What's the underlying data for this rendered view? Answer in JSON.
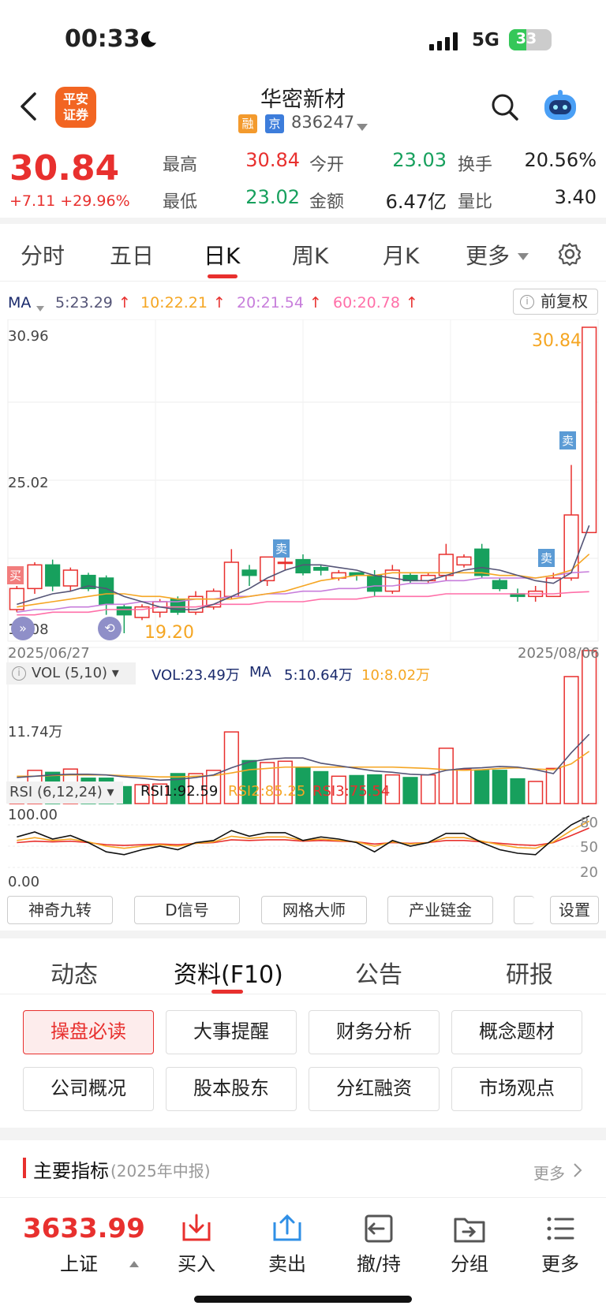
{
  "status_bar": {
    "time": "00:33",
    "network": "5G",
    "battery": "33"
  },
  "header": {
    "logo_line1": "平安",
    "logo_line2": "证券",
    "stock_name": "华密新材",
    "tag_rong": "融",
    "tag_jing": "京",
    "stock_code": "836247"
  },
  "quote": {
    "price": "30.84",
    "change": "+7.11 +29.96%",
    "high_label": "最高",
    "high": "30.84",
    "open_label": "今开",
    "open": "23.03",
    "turnover_label": "换手",
    "turnover": "20.56%",
    "low_label": "最低",
    "low": "23.02",
    "amount_label": "金额",
    "amount": "6.47亿",
    "vol_ratio_label": "量比",
    "vol_ratio": "3.40"
  },
  "chart_tabs": [
    {
      "label": "分时"
    },
    {
      "label": "五日"
    },
    {
      "label": "日K"
    },
    {
      "label": "周K"
    },
    {
      "label": "月K"
    },
    {
      "label": "更多"
    }
  ],
  "ma_bar": {
    "label": "MA",
    "ma5": "5:23.29",
    "ma10": "10:22.21",
    "ma20": "20:21.54",
    "ma60": "60:20.78",
    "adjust": "前复权"
  },
  "kline": {
    "y_top": "30.96",
    "y_mid": "25.02",
    "y_bottom": "19.08",
    "date_start": "2025/06/27",
    "date_end": "2025/08/06",
    "high_marker": "30.84",
    "low_marker": "19.20",
    "buy_label": "买",
    "sell_label": "卖"
  },
  "vol_bar": {
    "label": "VOL (5,10)",
    "vol": "VOL:23.49万",
    "ma": "MA",
    "ma5": "5:10.64万",
    "ma10": "10:8.02万",
    "y_label": "11.74万"
  },
  "rsi_bar": {
    "label": "RSI (6,12,24)",
    "rsi1": "RSI1:92.59",
    "rsi2": "RSI2:85.25",
    "rsi3": "RSI3:75.54",
    "y_top": "100.00",
    "y_bottom": "0.00",
    "r80": "80",
    "r50": "50",
    "r20": "20"
  },
  "indicator_buttons": [
    {
      "label": "神奇九转"
    },
    {
      "label": "D信号"
    },
    {
      "label": "网格大师"
    },
    {
      "label": "产业链金"
    },
    {
      "label": "设置"
    }
  ],
  "section_tabs": [
    {
      "label": "动态"
    },
    {
      "label": "资料(F10)"
    },
    {
      "label": "公告"
    },
    {
      "label": "研报"
    }
  ],
  "f10_buttons": [
    {
      "label": "操盘必读"
    },
    {
      "label": "大事提醒"
    },
    {
      "label": "财务分析"
    },
    {
      "label": "概念题材"
    },
    {
      "label": "公司概况"
    },
    {
      "label": "股本股东"
    },
    {
      "label": "分红融资"
    },
    {
      "label": "市场观点"
    }
  ],
  "indicators": {
    "title": "主要指标",
    "period": "(2025年中报)",
    "more": "更多"
  },
  "bottom_nav": {
    "index_value": "3633.99",
    "index_name": "上证",
    "items": [
      {
        "label": "买入"
      },
      {
        "label": "卖出"
      },
      {
        "label": "撤/持"
      },
      {
        "label": "分组"
      },
      {
        "label": "更多"
      }
    ]
  },
  "colors": {
    "up": "#e8302e",
    "down": "#17a05d",
    "ma5": "#555577",
    "ma10": "#f5a623",
    "ma20": "#c77ddb",
    "ma60": "#ff6fa8"
  },
  "chart_data": {
    "type": "candlestick",
    "x_range": [
      "2025/06/27",
      "2025/08/06"
    ],
    "ylim": [
      19.08,
      30.96
    ],
    "candles": [
      [
        20.1,
        20.9,
        20.0,
        21.0
      ],
      [
        20.9,
        21.8,
        20.7,
        21.9
      ],
      [
        21.8,
        21.0,
        20.8,
        22.0
      ],
      [
        21.0,
        21.6,
        20.8,
        21.7
      ],
      [
        21.4,
        20.9,
        20.8,
        21.5
      ],
      [
        21.3,
        20.3,
        19.9,
        21.4
      ],
      [
        20.2,
        19.9,
        19.2,
        20.3
      ],
      [
        19.8,
        20.2,
        19.7,
        20.3
      ],
      [
        20.0,
        20.4,
        19.8,
        20.5
      ],
      [
        20.5,
        20.0,
        19.9,
        20.6
      ],
      [
        20.0,
        20.6,
        19.9,
        20.8
      ],
      [
        20.2,
        20.8,
        20.1,
        20.9
      ],
      [
        20.6,
        21.9,
        20.5,
        22.4
      ],
      [
        21.6,
        21.4,
        21.0,
        21.8
      ],
      [
        21.2,
        22.1,
        21.0,
        22.1
      ],
      [
        21.9,
        21.9,
        21.6,
        22.2
      ],
      [
        22.0,
        21.5,
        21.4,
        22.2
      ],
      [
        21.7,
        21.6,
        21.4,
        21.8
      ],
      [
        21.3,
        21.5,
        21.2,
        21.6
      ],
      [
        21.5,
        21.4,
        21.2,
        21.5
      ],
      [
        21.4,
        20.8,
        20.6,
        21.6
      ],
      [
        20.8,
        21.6,
        20.7,
        21.8
      ],
      [
        21.4,
        21.2,
        21.1,
        21.5
      ],
      [
        21.2,
        21.4,
        21.1,
        21.5
      ],
      [
        21.4,
        22.2,
        21.2,
        22.6
      ],
      [
        21.8,
        22.1,
        21.7,
        22.2
      ],
      [
        22.4,
        21.4,
        21.3,
        22.6
      ],
      [
        21.2,
        20.9,
        20.8,
        21.3
      ],
      [
        20.7,
        20.6,
        20.4,
        20.9
      ],
      [
        20.6,
        20.8,
        20.4,
        21.0
      ],
      [
        20.6,
        21.3,
        20.6,
        21.5
      ],
      [
        21.3,
        23.7,
        21.2,
        25.6
      ],
      [
        23.03,
        30.84,
        23.02,
        30.84
      ]
    ],
    "ma5": [
      20.3,
      20.5,
      20.7,
      20.8,
      21.0,
      20.9,
      20.6,
      20.4,
      20.2,
      20.1,
      20.1,
      20.3,
      20.6,
      20.9,
      21.3,
      21.6,
      21.8,
      21.8,
      21.7,
      21.6,
      21.4,
      21.3,
      21.2,
      21.2,
      21.4,
      21.6,
      21.7,
      21.6,
      21.4,
      21.2,
      21.1,
      21.5,
      23.3
    ],
    "ma10": [
      20.2,
      20.3,
      20.4,
      20.5,
      20.6,
      20.7,
      20.7,
      20.6,
      20.6,
      20.5,
      20.5,
      20.5,
      20.5,
      20.6,
      20.7,
      20.8,
      21.0,
      21.2,
      21.3,
      21.4,
      21.4,
      21.5,
      21.5,
      21.5,
      21.5,
      21.5,
      21.5,
      21.4,
      21.4,
      21.3,
      21.4,
      21.6,
      22.21
    ],
    "ma20": [
      20.0,
      20.1,
      20.1,
      20.2,
      20.2,
      20.3,
      20.3,
      20.4,
      20.4,
      20.4,
      20.5,
      20.5,
      20.6,
      20.6,
      20.7,
      20.7,
      20.8,
      20.8,
      20.9,
      20.9,
      21.0,
      21.0,
      21.1,
      21.1,
      21.2,
      21.2,
      21.3,
      21.3,
      21.3,
      21.3,
      21.4,
      21.5,
      21.54
    ],
    "ma60": [
      19.9,
      19.9,
      20.0,
      20.0,
      20.0,
      20.1,
      20.1,
      20.1,
      20.2,
      20.2,
      20.2,
      20.3,
      20.3,
      20.3,
      20.4,
      20.4,
      20.4,
      20.5,
      20.5,
      20.5,
      20.6,
      20.6,
      20.6,
      20.6,
      20.7,
      20.7,
      20.7,
      20.7,
      20.7,
      20.7,
      20.7,
      20.75,
      20.78
    ],
    "volume": [
      3.2,
      5.1,
      4.8,
      5.3,
      3.9,
      3.9,
      2.6,
      2.9,
      3.0,
      4.6,
      4.6,
      5.1,
      11.0,
      6.6,
      6.3,
      6.5,
      5.5,
      4.9,
      4.2,
      4.3,
      4.4,
      4.4,
      4.0,
      4.4,
      8.5,
      5.3,
      5.1,
      5.1,
      3.8,
      3.4,
      5.4,
      19.5,
      23.49
    ],
    "vol_ma5": [
      4.0,
      4.2,
      4.4,
      4.5,
      4.5,
      4.4,
      4.1,
      3.9,
      3.6,
      3.7,
      4.0,
      4.4,
      5.5,
      6.4,
      6.8,
      7.0,
      7.0,
      6.2,
      5.8,
      5.4,
      5.0,
      4.8,
      4.5,
      4.4,
      5.1,
      5.4,
      5.5,
      5.7,
      5.6,
      5.2,
      4.6,
      7.8,
      10.64
    ],
    "vol_ma10": [
      4.2,
      4.2,
      4.3,
      4.4,
      4.4,
      4.4,
      4.3,
      4.2,
      4.1,
      4.1,
      4.2,
      4.3,
      4.7,
      5.2,
      5.4,
      5.6,
      5.6,
      5.6,
      5.6,
      5.6,
      5.6,
      5.6,
      5.5,
      5.4,
      5.2,
      5.1,
      5.2,
      5.4,
      5.5,
      5.3,
      5.2,
      6.1,
      8.02
    ],
    "vol_ylim": [
      0,
      23.49
    ],
    "rsi1": [
      63,
      70,
      60,
      65,
      55,
      42,
      38,
      45,
      50,
      45,
      55,
      58,
      72,
      64,
      69,
      69,
      58,
      63,
      60,
      55,
      42,
      58,
      50,
      55,
      68,
      68,
      55,
      45,
      40,
      38,
      60,
      80,
      92.59
    ],
    "rsi2": [
      58,
      62,
      58,
      60,
      56,
      50,
      47,
      50,
      52,
      50,
      54,
      56,
      64,
      61,
      63,
      63,
      58,
      60,
      58,
      56,
      50,
      56,
      53,
      55,
      62,
      62,
      57,
      52,
      48,
      47,
      56,
      72,
      85.25
    ],
    "rsi3": [
      55,
      57,
      56,
      57,
      55,
      52,
      51,
      52,
      53,
      52,
      54,
      55,
      59,
      58,
      59,
      59,
      57,
      58,
      57,
      56,
      53,
      55,
      54,
      55,
      58,
      58,
      56,
      54,
      52,
      51,
      55,
      65,
      75.54
    ],
    "rsi_ylim": [
      0,
      100
    ]
  }
}
